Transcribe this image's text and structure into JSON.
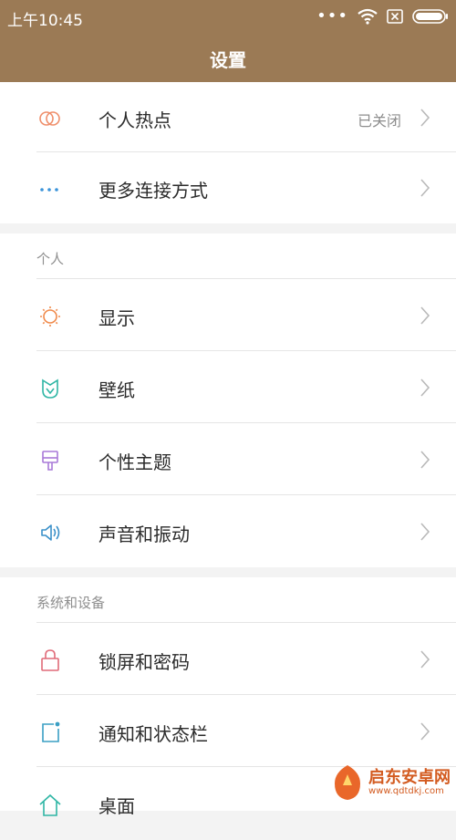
{
  "status_bar": {
    "time": "上午10:45",
    "dots": "•••"
  },
  "header": {
    "title": "设置"
  },
  "connections": {
    "hotspot": {
      "label": "个人热点",
      "value": "已关闭",
      "icon": "hotspot-rings-icon",
      "color": "#ef8f6b"
    },
    "more": {
      "label": "更多连接方式",
      "icon": "more-dots-icon",
      "color": "#3a93d9"
    }
  },
  "personal": {
    "header": "个人",
    "items": [
      {
        "label": "显示",
        "icon": "sun-icon",
        "color": "#f08a4b"
      },
      {
        "label": "壁纸",
        "icon": "tulip-icon",
        "color": "#2fb6a5"
      },
      {
        "label": "个性主题",
        "icon": "brush-icon",
        "color": "#a97ad8"
      },
      {
        "label": "声音和振动",
        "icon": "speaker-icon",
        "color": "#3a90c9"
      }
    ]
  },
  "system": {
    "header": "系统和设备",
    "items": [
      {
        "label": "锁屏和密码",
        "icon": "lock-icon",
        "color": "#e06a78"
      },
      {
        "label": "通知和状态栏",
        "icon": "notification-icon",
        "color": "#3a9fc4"
      },
      {
        "label": "桌面",
        "icon": "home-icon",
        "color": "#2fb6a5"
      }
    ]
  },
  "watermark": {
    "text": "启东安卓网",
    "url": "www.qdtdkj.com"
  }
}
